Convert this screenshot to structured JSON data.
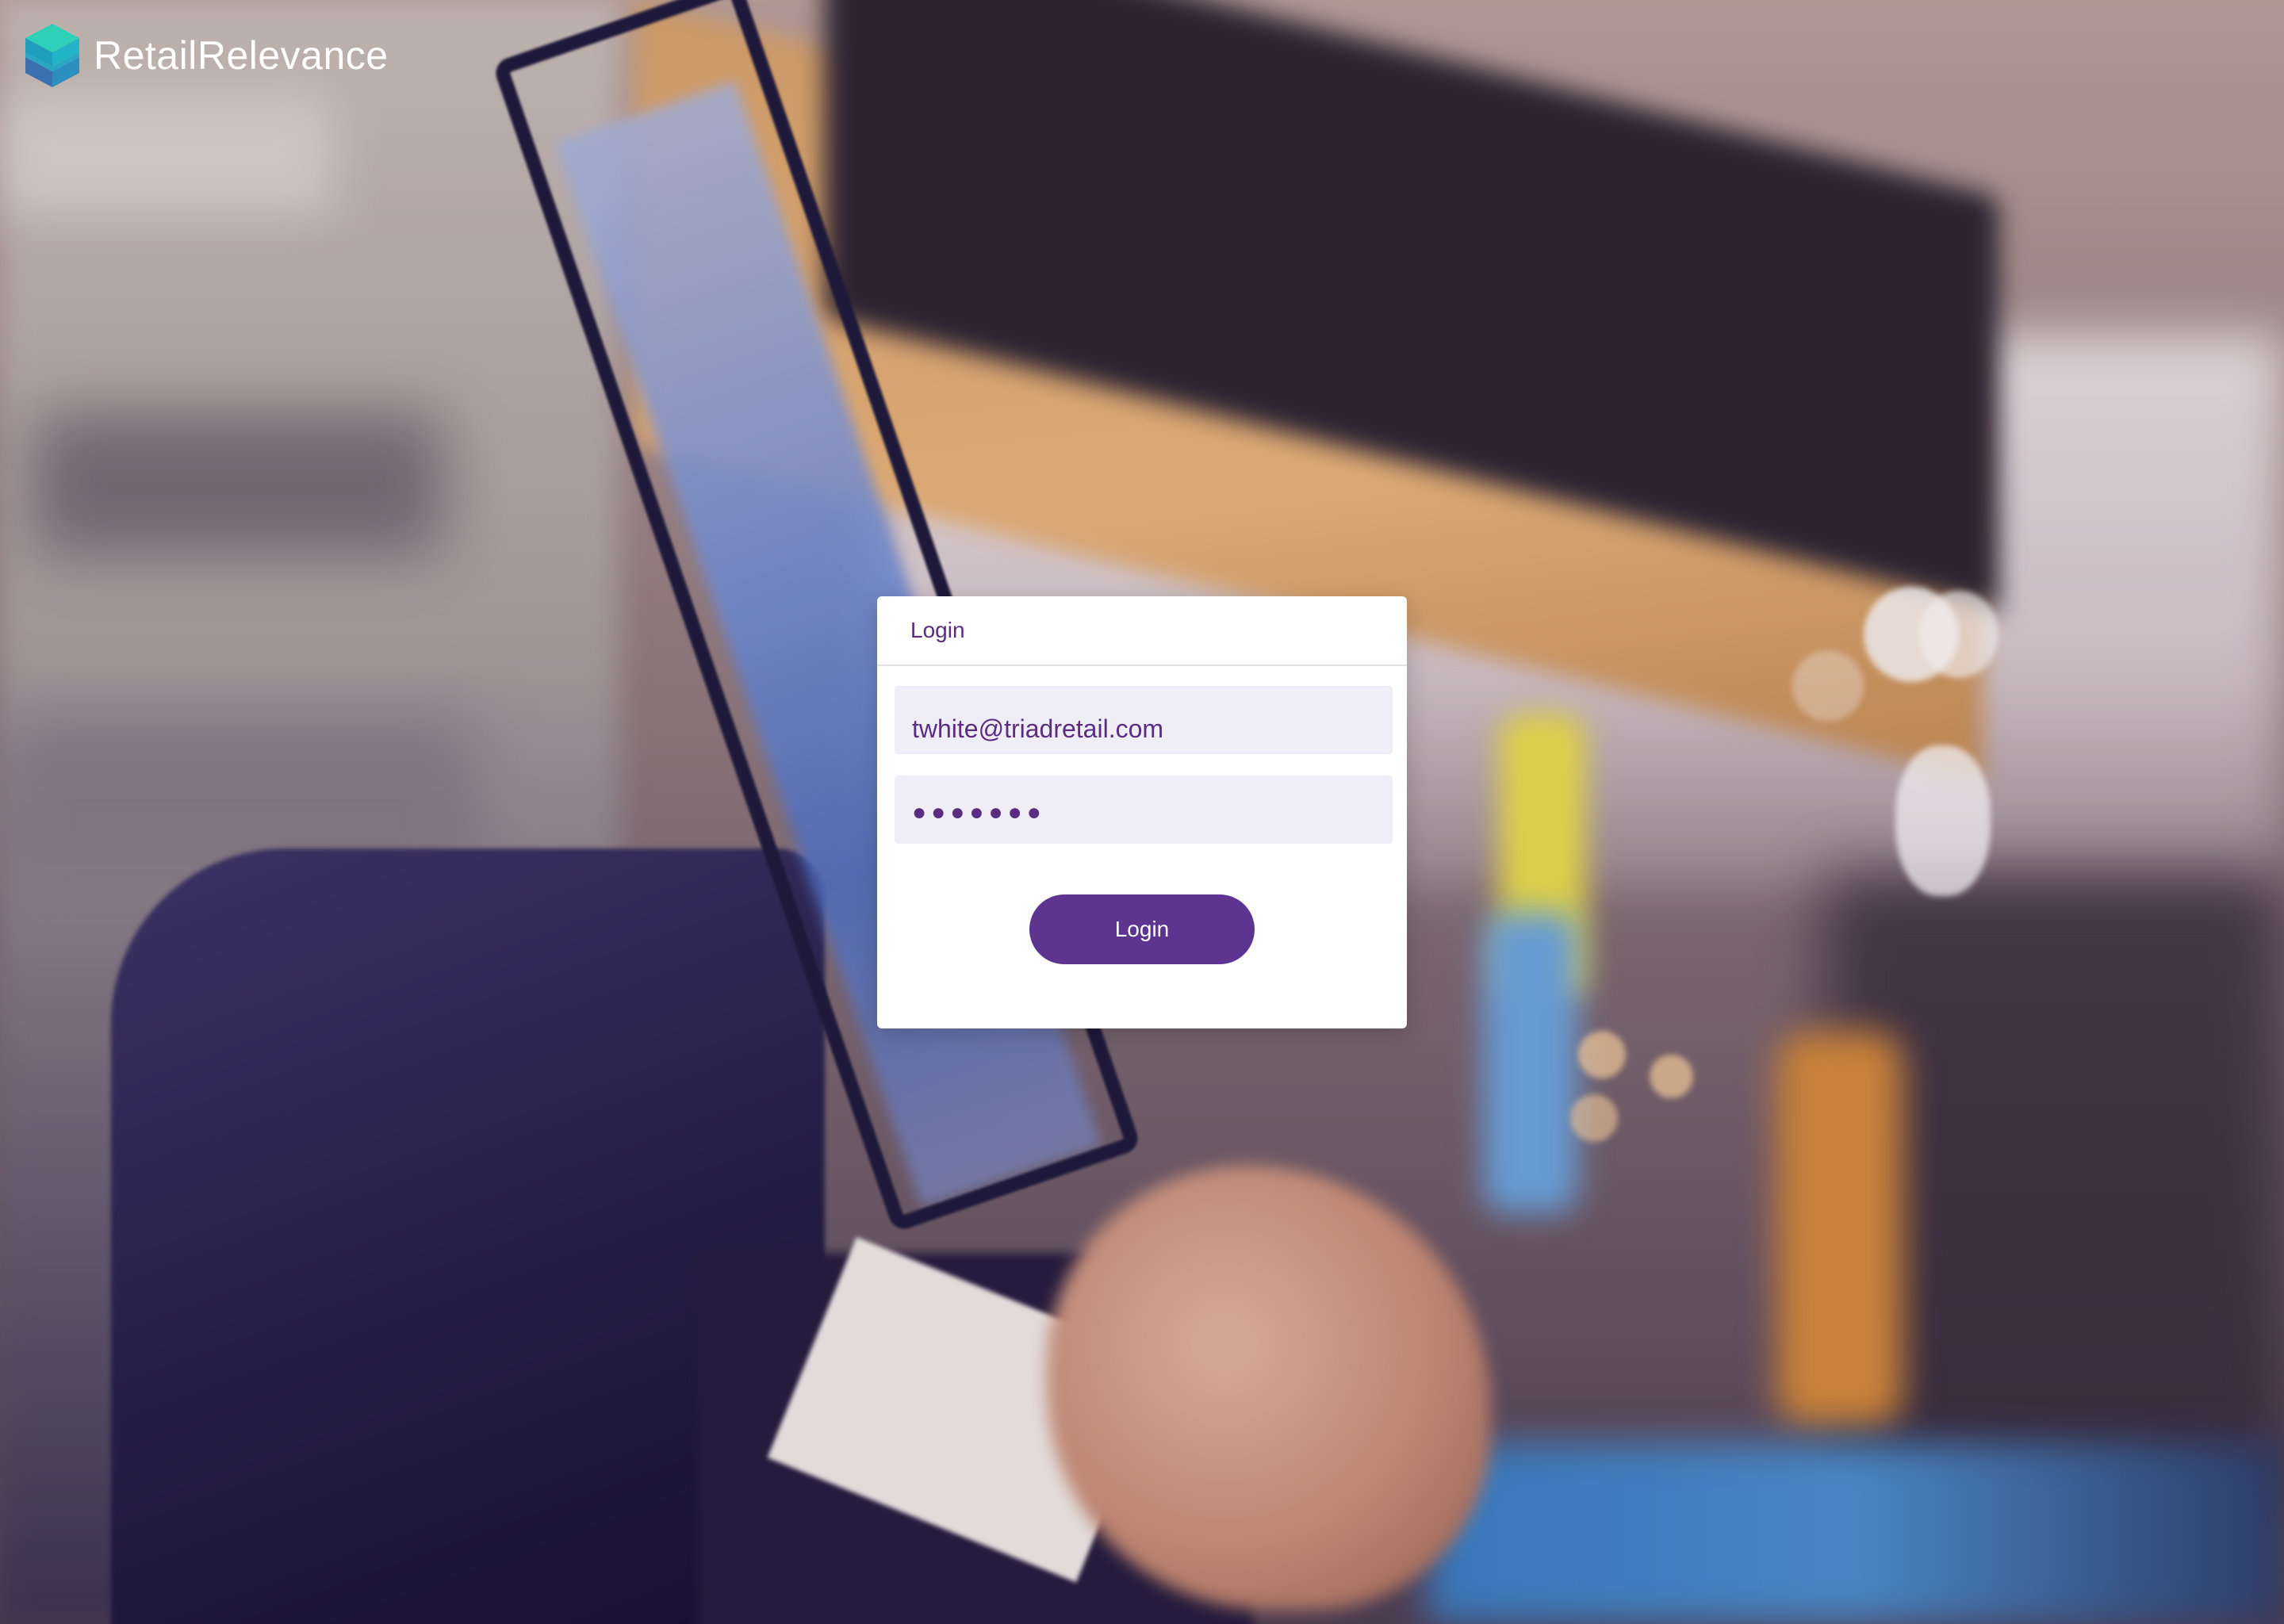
{
  "brand": {
    "name": "RetailRelevance",
    "logo_icon": "stacked-cubes-icon",
    "accent_color": "#5e3491",
    "logo_colors": [
      "#2fd0b8",
      "#1e9fbd",
      "#3b6fb0"
    ]
  },
  "login": {
    "title": "Login",
    "email_value": "twhite@triadretail.com",
    "password_mask": "●●●●●●●",
    "button_label": "Login"
  }
}
